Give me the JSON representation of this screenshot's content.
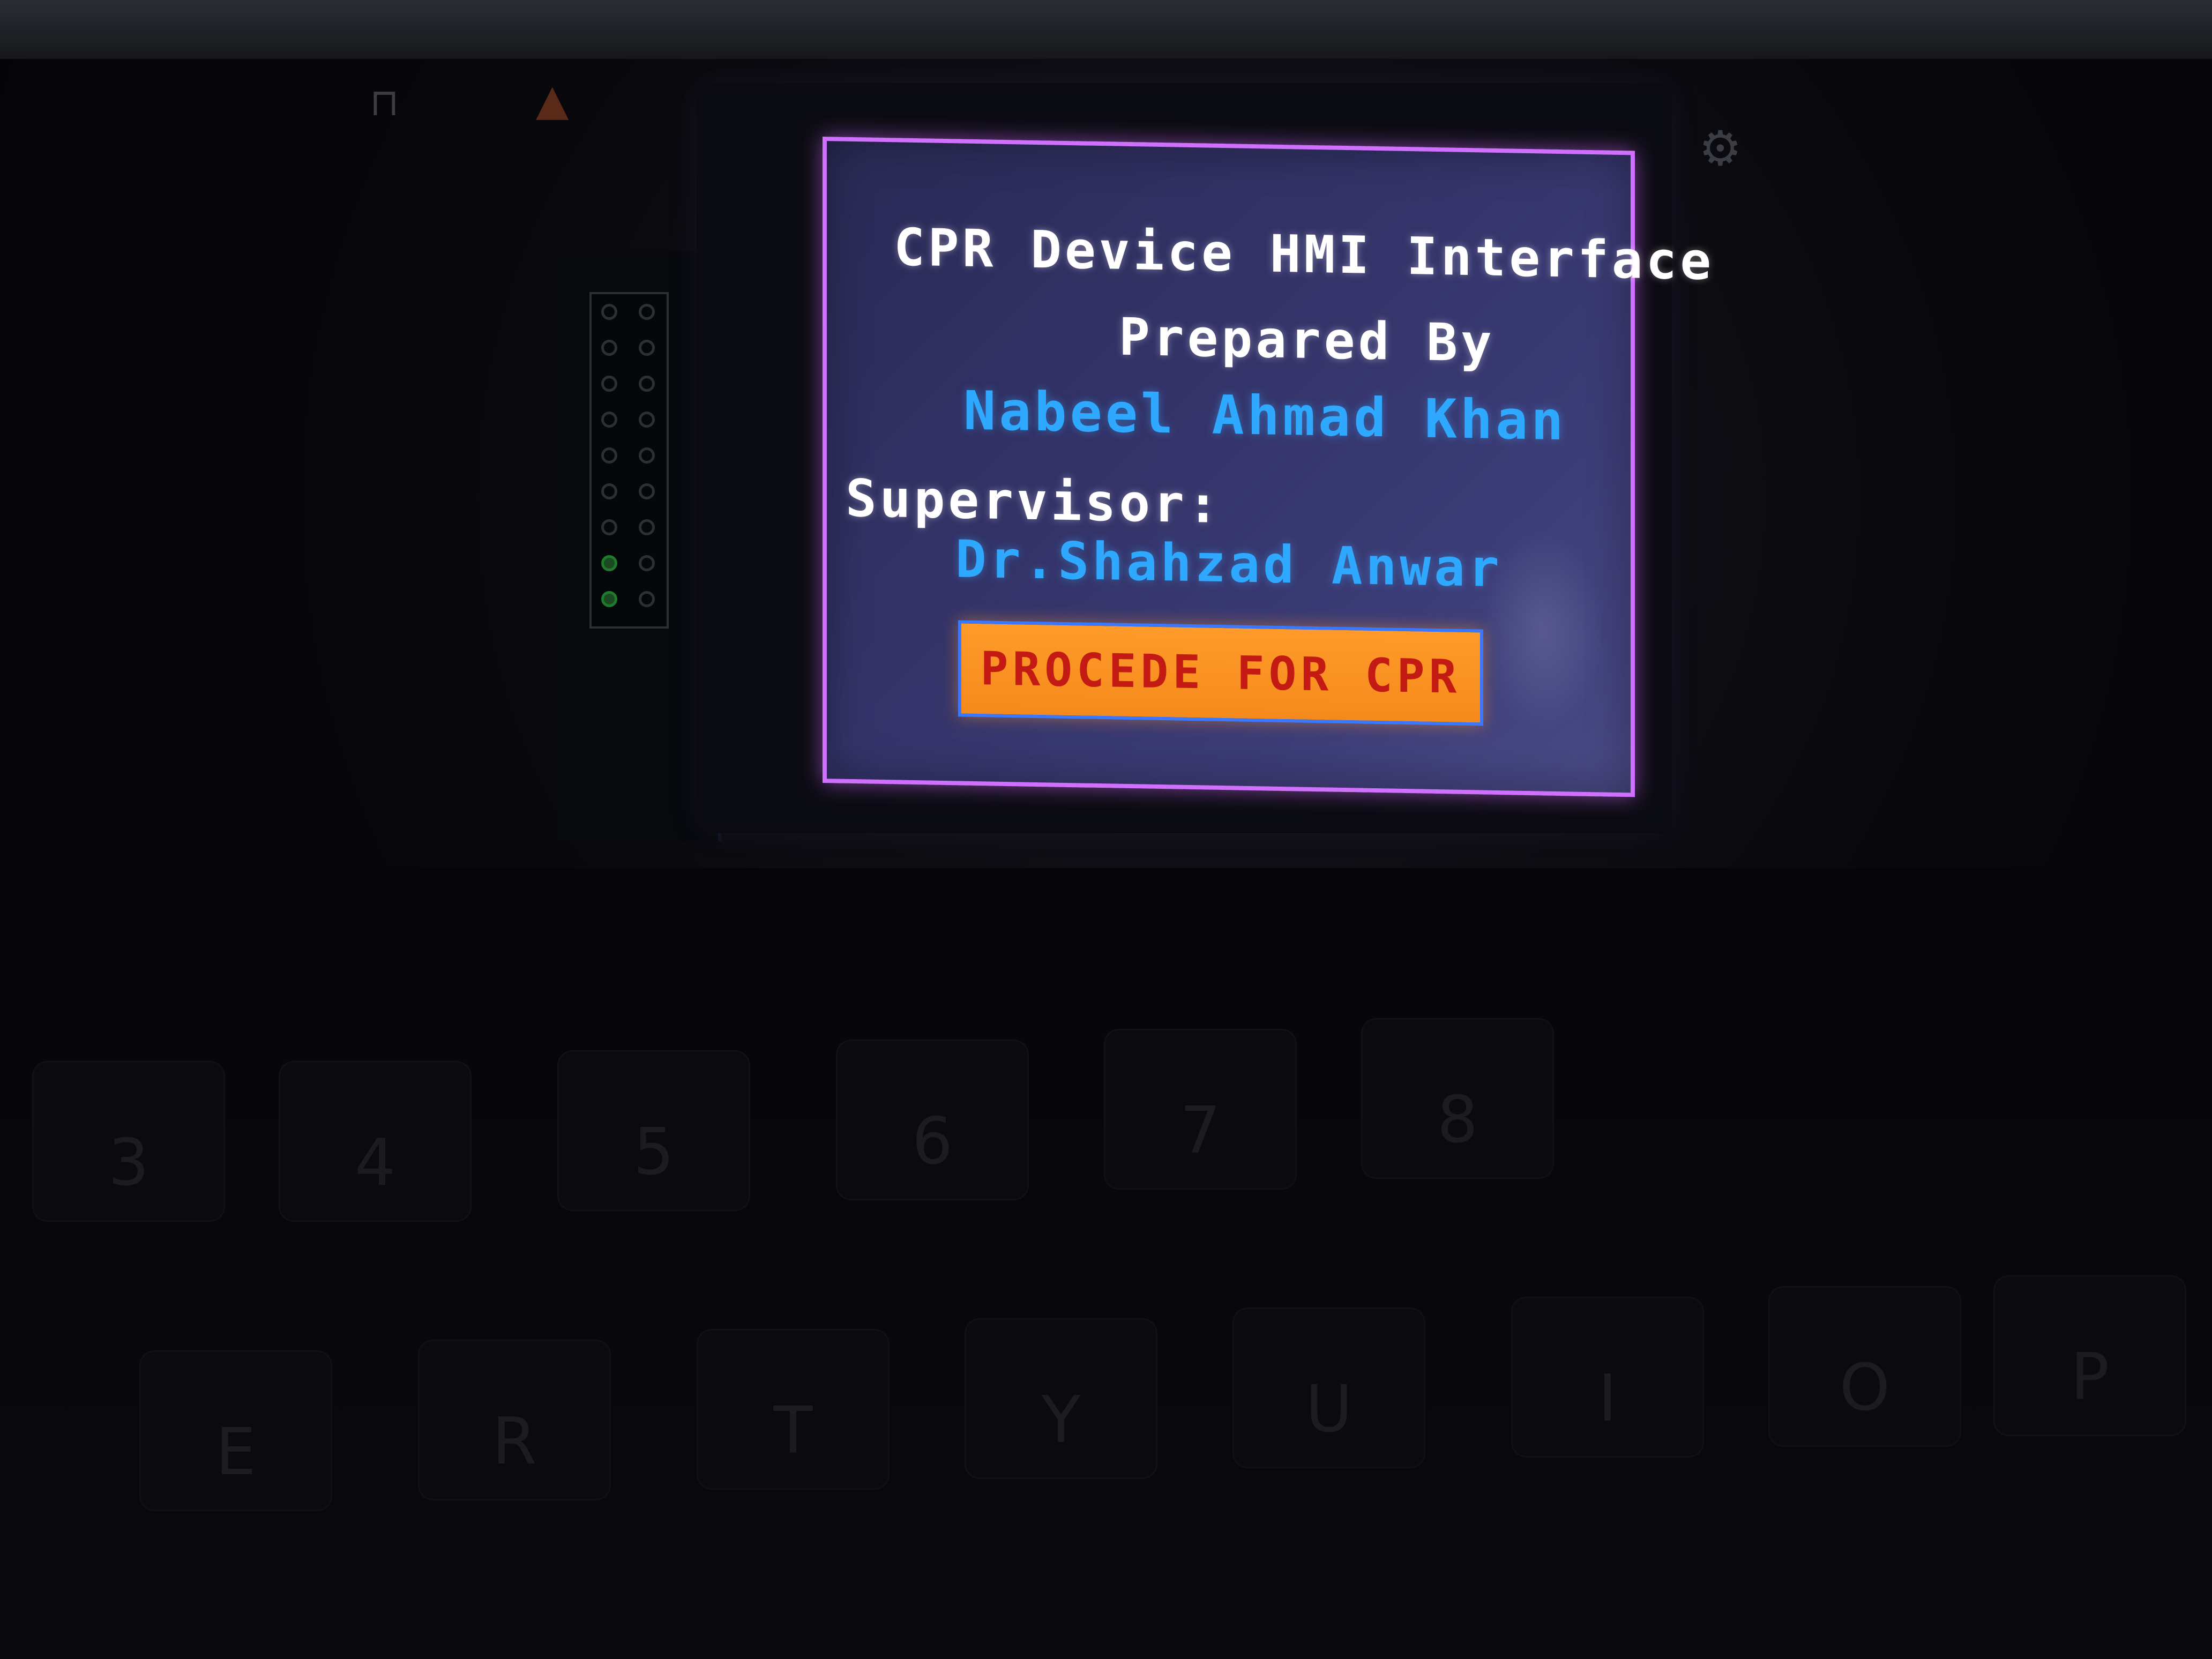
{
  "screen": {
    "title": "CPR Device HMI Interface",
    "prepared_label": "Prepared By",
    "author": "Nabeel Ahmad Khan",
    "supervisor_label": "Supervisor:",
    "supervisor_name": "Dr.Shahzad Anwar",
    "button_label": "PROCEDE FOR CPR"
  },
  "colors": {
    "panel_background": "#34346a",
    "panel_border": "#d070ff",
    "heading_text": "#ffffff",
    "name_text": "#2fa8ff",
    "button_fill": "#ff9b2a",
    "button_text": "#c41a14",
    "button_border": "#3a78ff"
  },
  "background": {
    "keyboard_keys": [
      "3",
      "4",
      "5",
      "6",
      "7",
      "8",
      "E",
      "R",
      "T",
      "Y",
      "U",
      "I",
      "O",
      "P"
    ]
  }
}
